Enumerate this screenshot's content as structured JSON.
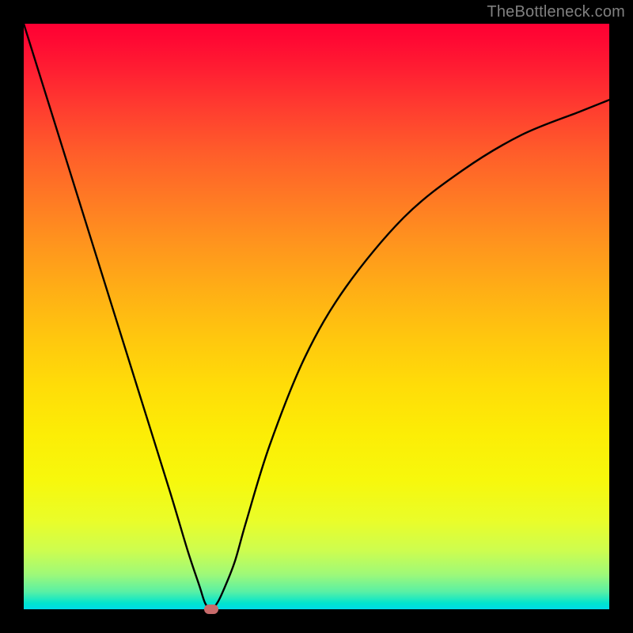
{
  "watermark": "TheBottleneck.com",
  "chart_data": {
    "type": "line",
    "title": "",
    "xlabel": "",
    "ylabel": "",
    "xlim": [
      0,
      100
    ],
    "ylim": [
      0,
      100
    ],
    "series": [
      {
        "name": "curve",
        "x": [
          0,
          5,
          10,
          15,
          20,
          25,
          28,
          30,
          31,
          32,
          33,
          34,
          36,
          38,
          42,
          48,
          55,
          65,
          75,
          85,
          95,
          100
        ],
        "y": [
          100,
          84,
          68,
          52,
          36,
          20,
          10,
          4,
          1,
          0,
          1,
          3,
          8,
          15,
          28,
          43,
          55,
          67,
          75,
          81,
          85,
          87
        ]
      }
    ],
    "marker": {
      "x": 32,
      "y": 0,
      "color": "#c96b6b"
    },
    "gradient_stops": [
      {
        "pos": 0,
        "color": "#ff0033"
      },
      {
        "pos": 50,
        "color": "#ffcc00"
      },
      {
        "pos": 78,
        "color": "#f7f80c"
      },
      {
        "pos": 100,
        "color": "#00dbe8"
      }
    ]
  }
}
